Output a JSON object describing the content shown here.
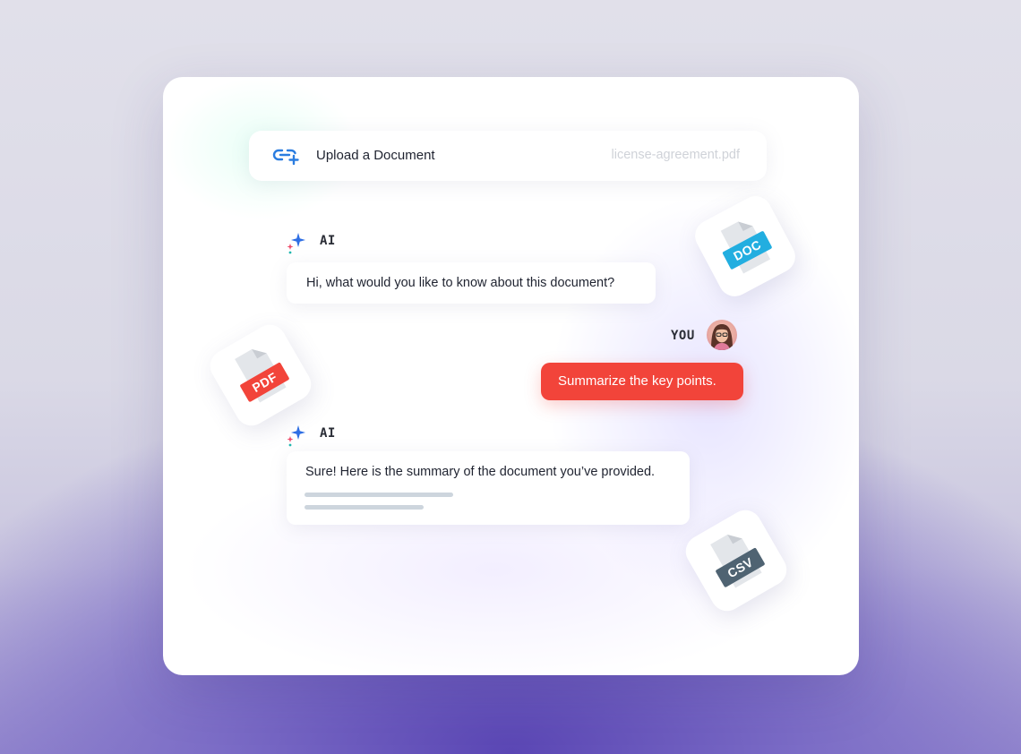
{
  "upload": {
    "label": "Upload a Document",
    "filename": "license-agreement.pdf",
    "icon": "link-add-icon"
  },
  "messages": [
    {
      "speaker": "AI",
      "text": "Hi, what would you like to know about this document?"
    },
    {
      "speaker": "YOU",
      "text": "Summarize the key points."
    },
    {
      "speaker": "AI",
      "text": "Sure! Here is the summary of the document you’ve provided."
    }
  ],
  "file_types": {
    "doc": {
      "label": "DOC",
      "color": "#22aee0"
    },
    "pdf": {
      "label": "PDF",
      "color": "#f2443a"
    },
    "csv": {
      "label": "CSV",
      "color": "#4f6372"
    }
  },
  "colors": {
    "accent_user": "#f2443a",
    "link_icon": "#2b7de0"
  }
}
